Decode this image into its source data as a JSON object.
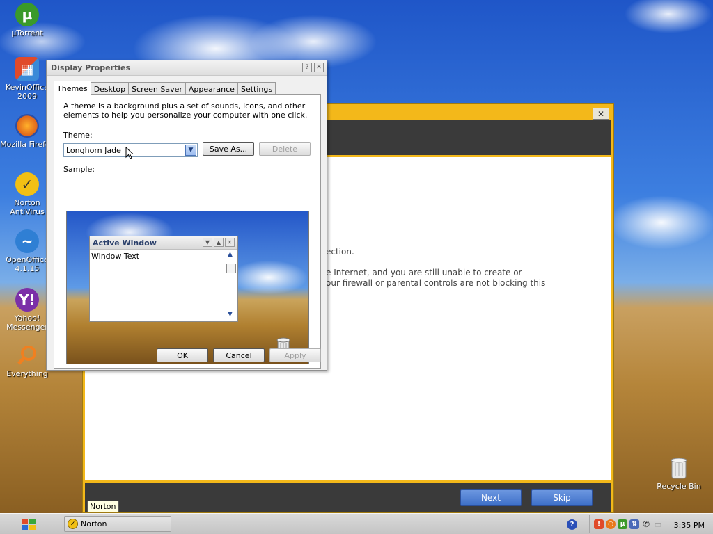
{
  "desktop": {
    "icons": [
      {
        "label": "µTorrent",
        "icon": "utorrent-icon",
        "color": "#3a9a2a"
      },
      {
        "label": "KevinOffice 2009",
        "icon": "office-icon",
        "color": "#d8842a"
      },
      {
        "label": "Mozilla Firefox",
        "icon": "firefox-icon",
        "color": "#e0661a"
      },
      {
        "label": "Norton AntiVirus",
        "icon": "norton-icon",
        "color": "#f2c014"
      },
      {
        "label": "OpenOffice 4.1.15",
        "icon": "openoffice-icon",
        "color": "#2f7fd4"
      },
      {
        "label": "Yahoo! Messenger",
        "icon": "yahoo-icon",
        "color": "#7b2fa8"
      },
      {
        "label": "Everything",
        "icon": "everything-icon",
        "color": "#e8781a"
      }
    ],
    "recycle_bin": "Recycle Bin"
  },
  "norton": {
    "close_label": "✕",
    "line1": "ection.",
    "line2": "e Internet, and you are still unable to create or",
    "line3": "our firewall or parental controls are not blocking this",
    "next_label": "Next",
    "skip_label": "Skip",
    "tooltip": "Norton"
  },
  "dialog": {
    "title": "Display Properties",
    "help_btn": "?",
    "close_btn": "✕",
    "tabs": [
      "Themes",
      "Desktop",
      "Screen Saver",
      "Appearance",
      "Settings"
    ],
    "active_tab": "Themes",
    "description": "A theme is a background plus a set of sounds, icons, and other elements to help you personalize your computer with one click.",
    "theme_label": "Theme:",
    "theme_value": "Longhorn Jade",
    "save_as_label": "Save As...",
    "delete_label": "Delete",
    "sample_label": "Sample:",
    "sample": {
      "window_title": "Active Window",
      "window_text": "Window Text"
    },
    "ok_label": "OK",
    "cancel_label": "Cancel",
    "apply_label": "Apply"
  },
  "taskbar": {
    "task_label": "Norton",
    "clock": "3:35 PM"
  }
}
